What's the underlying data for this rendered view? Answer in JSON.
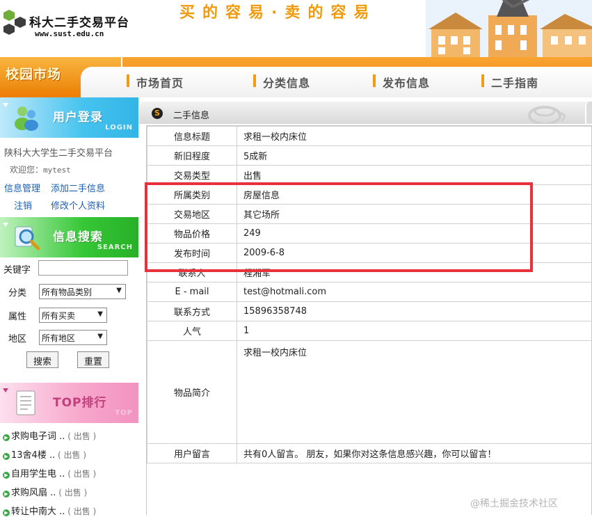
{
  "header": {
    "site_name": "科大二手交易平台",
    "site_url": "www.sust.edu.cn",
    "slogan": "买的容易·卖的容易"
  },
  "nav": {
    "campus_label": "校园市场",
    "items": [
      {
        "label": "市场首页"
      },
      {
        "label": "分类信息"
      },
      {
        "label": "发布信息"
      },
      {
        "label": "二手指南"
      }
    ]
  },
  "sidebar": {
    "login_banner": {
      "title": "用户登录",
      "subtitle": "LOGIN"
    },
    "site_title": "陕科大大学生二手交易平台",
    "welcome_prefix": "欢迎您：",
    "username": "mytest",
    "links": {
      "manage": "信息管理",
      "add": "添加二手信息",
      "logout": "注销",
      "profile": "修改个人资料"
    },
    "search_banner": {
      "title": "信息搜索",
      "subtitle": "SEARCH"
    },
    "search": {
      "keyword_label": "关键字",
      "keyword_value": "",
      "category_label": "分类",
      "category_value": "所有物品类别",
      "attribute_label": "属性",
      "attribute_value": "所有买卖",
      "region_label": "地区",
      "region_value": "所有地区",
      "search_button": "搜索",
      "reset_button": "重置"
    },
    "top_banner": {
      "title": "TOP排行",
      "subtitle": "TOP"
    },
    "top_items": [
      {
        "title": "求购电子词 ..",
        "status": "出售"
      },
      {
        "title": "13舍4楼 ..",
        "status": "出售"
      },
      {
        "title": "自用学生电 ..",
        "status": "出售"
      },
      {
        "title": "求购风扇 ..",
        "status": "出售"
      },
      {
        "title": "转让中南大 ..",
        "status": "出售"
      }
    ]
  },
  "content": {
    "section_title": "二手信息",
    "rows": [
      {
        "label": "信息标题",
        "value": "求租一校内床位"
      },
      {
        "label": "新旧程度",
        "value": "5成新"
      },
      {
        "label": "交易类型",
        "value": "出售"
      },
      {
        "label": "所属类别",
        "value": "房屋信息"
      },
      {
        "label": "交易地区",
        "value": "其它场所"
      },
      {
        "label": "物品价格",
        "value": "249"
      },
      {
        "label": "发布时间",
        "value": "2009-6-8"
      },
      {
        "label": "联系人",
        "value": "程湘军"
      },
      {
        "label": "E - mail",
        "value": "test@hotmali.com"
      },
      {
        "label": "联系方式",
        "value": "15896358748"
      },
      {
        "label": "人气",
        "value": "1"
      },
      {
        "label": "物品简介",
        "value": "求租一校内床位"
      },
      {
        "label": "用户留言",
        "value": "共有0人留言。 朋友，如果你对这条信息感兴趣，你可以留言！"
      }
    ]
  },
  "watermark": "@稀土掘金技术社区",
  "colors": {
    "nav_orange": "#ee7e06",
    "highlight_red": "#e8313a",
    "link_blue": "#1a5fb4"
  }
}
